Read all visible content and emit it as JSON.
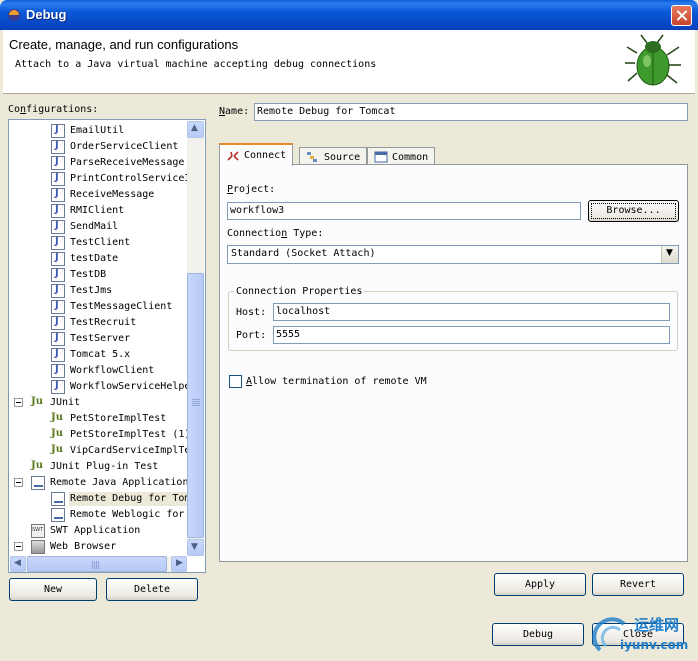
{
  "window": {
    "title": "Debug"
  },
  "header": {
    "title": "Create, manage, and run configurations",
    "message": "Attach to a Java virtual machine accepting debug connections"
  },
  "configurations": {
    "label": "Configurations:",
    "items": [
      {
        "label": "EmailUtil",
        "type": "java"
      },
      {
        "label": "OrderServiceClient",
        "type": "java"
      },
      {
        "label": "ParseReceiveMessage",
        "type": "java"
      },
      {
        "label": "PrintControlServiceI",
        "type": "java"
      },
      {
        "label": "ReceiveMessage",
        "type": "java"
      },
      {
        "label": "RMIClient",
        "type": "java"
      },
      {
        "label": "SendMail",
        "type": "java"
      },
      {
        "label": "TestClient",
        "type": "java"
      },
      {
        "label": "testDate",
        "type": "java"
      },
      {
        "label": "TestDB",
        "type": "java"
      },
      {
        "label": "TestJms",
        "type": "java"
      },
      {
        "label": "TestMessageClient",
        "type": "java"
      },
      {
        "label": "TestRecruit",
        "type": "java"
      },
      {
        "label": "TestServer",
        "type": "java"
      },
      {
        "label": "Tomcat 5.x",
        "type": "java"
      },
      {
        "label": "WorkflowClient",
        "type": "java"
      },
      {
        "label": "WorkflowServiceHelpe",
        "type": "java"
      },
      {
        "label": "JUnit",
        "type": "junit-group"
      },
      {
        "label": "PetStoreImplTest",
        "type": "junit"
      },
      {
        "label": "PetStoreImplTest (1)",
        "type": "junit"
      },
      {
        "label": "VipCardServiceImplTe",
        "type": "junit"
      },
      {
        "label": "JUnit Plug-in Test",
        "type": "junit-plugin"
      },
      {
        "label": "Remote Java Application",
        "type": "remote-group"
      },
      {
        "label": "Remote Debug for Tom",
        "type": "remote",
        "selected": true
      },
      {
        "label": "Remote Weblogic for",
        "type": "remote"
      },
      {
        "label": "SWT Application",
        "type": "swt"
      },
      {
        "label": "Web Browser",
        "type": "web"
      }
    ]
  },
  "left_buttons": {
    "new": "New",
    "delete": "Delete"
  },
  "name": {
    "label": "Name:",
    "value": "Remote Debug for Tomcat"
  },
  "tabs": [
    {
      "label": "Connect",
      "icon": "connect-icon",
      "active": true
    },
    {
      "label": "Source",
      "icon": "source-icon"
    },
    {
      "label": "Common",
      "icon": "common-icon"
    }
  ],
  "connect": {
    "project_label": "Project:",
    "project_value": "workflow3",
    "browse_label": "Browse...",
    "conntype_label": "Connection Type:",
    "conntype_value": "Standard (Socket Attach)",
    "group_title": "Connection Properties",
    "host_label": "Host:",
    "host_value": "localhost",
    "port_label": "Port:",
    "port_value": "5555",
    "allow_label": "Allow termination of remote VM",
    "allow_checked": false
  },
  "buttons": {
    "apply": "Apply",
    "revert": "Revert",
    "debug": "Debug",
    "close": "Close"
  },
  "watermark": {
    "top": "运维网",
    "bottom": "iyunv.com"
  },
  "colors": {
    "title_bar": "#0a58d6",
    "dialog_bg": "#ece9d8",
    "tab_accent": "#e68b2c"
  }
}
